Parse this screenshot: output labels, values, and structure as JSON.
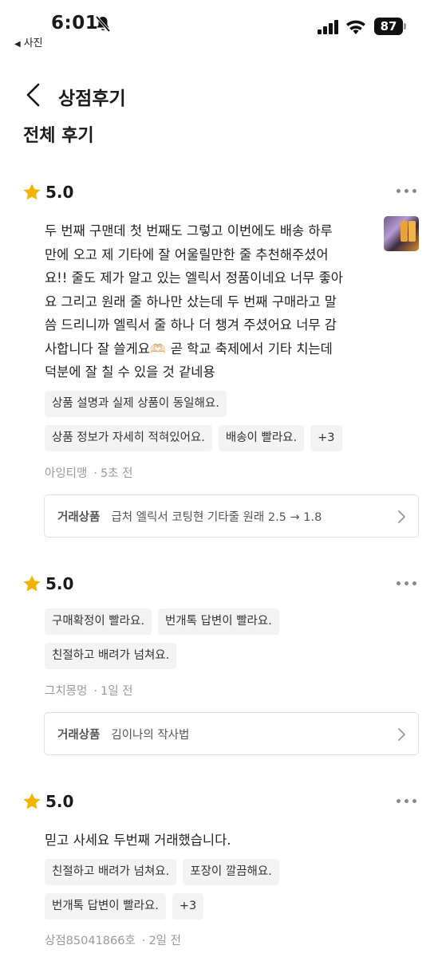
{
  "status_bar": {
    "time": "6:01",
    "back_app": "사진",
    "battery": "87"
  },
  "header": {
    "title": "상점후기",
    "section_title": "전체 후기"
  },
  "reviews": [
    {
      "score": "5.0",
      "text": "두 번째 구맨데 첫 번째도 그렇고 이번에도 배송 하루만에 오고 제 기타에 잘 어울릴만한 줄 추천해주셨어요!! 줄도 제가 알고 있는 엘릭서 정품이네요 너무 좋아요 그리고 원래 줄 하나만 샀는데 두 번째 구매라고 말씀 드리니까 엘릭서 줄 하나 더 챙겨 주셨어요 너무 감사합니다 잘 쓸게요🫶🏻 곧 학교 축제에서 기타 치는데 덕분에 잘 칠 수 있을 것 같네용",
      "lines": [
        "두 번째 구맨데 첫 번째도 그렇고 이번에도 배송 하루",
        "만에 오고 제 기타에 잘 어울릴만한 줄 추천해주셨어",
        "요!! 줄도 제가 알고 있는 엘릭서 정품이네요 너무 좋아",
        "요 그리고 원래 줄 하나만 샀는데 두 번째 구매라고 말",
        "씀 드리니까 엘릭서 줄 하나 더 챙겨 주셨어요 너무 감",
        "사합니다 잘 쓸게요🫶🏻 곧 학교 축제에서 기타 치는데",
        "덕분에 잘 칠 수 있을 것 같네용"
      ],
      "tags_row1": [
        "상품 설명과 실제 상품이 동일해요."
      ],
      "tags_row2": [
        "상품 정보가 자세히 적혀있어요.",
        "배송이 빨라요.",
        "+3"
      ],
      "author": "아잉티맹",
      "time": "5초 전",
      "product_label": "거래상품",
      "product_name": "급처 엘릭서 코팅현 기타줄 원래 2.5 → 1.8"
    },
    {
      "score": "5.0",
      "tags_row1": [
        "구매확정이 빨라요.",
        "번개톡 답변이 빨라요."
      ],
      "tags_row2": [
        "친절하고 배려가 넘쳐요."
      ],
      "author": "그치몽멍",
      "time": "1일 전",
      "product_label": "거래상품",
      "product_name": "김이나의 작사법"
    },
    {
      "score": "5.0",
      "text": "믿고 사세요 두번째 거래했습니다.",
      "tags_row1": [
        "친절하고 배려가 넘쳐요.",
        "포장이 깔끔해요."
      ],
      "tags_row2": [
        "번개톡 답변이 빨라요.",
        "+3"
      ],
      "author": "상점85041866호",
      "time": "2일 전"
    }
  ],
  "icons": {
    "star": "star-icon",
    "more": "more-options-icon",
    "back": "chevron-left-icon",
    "chevron": "chevron-right-icon"
  },
  "colors": {
    "star": "#f5b301",
    "tag_bg": "#f3f3f3",
    "meta": "#999999"
  }
}
